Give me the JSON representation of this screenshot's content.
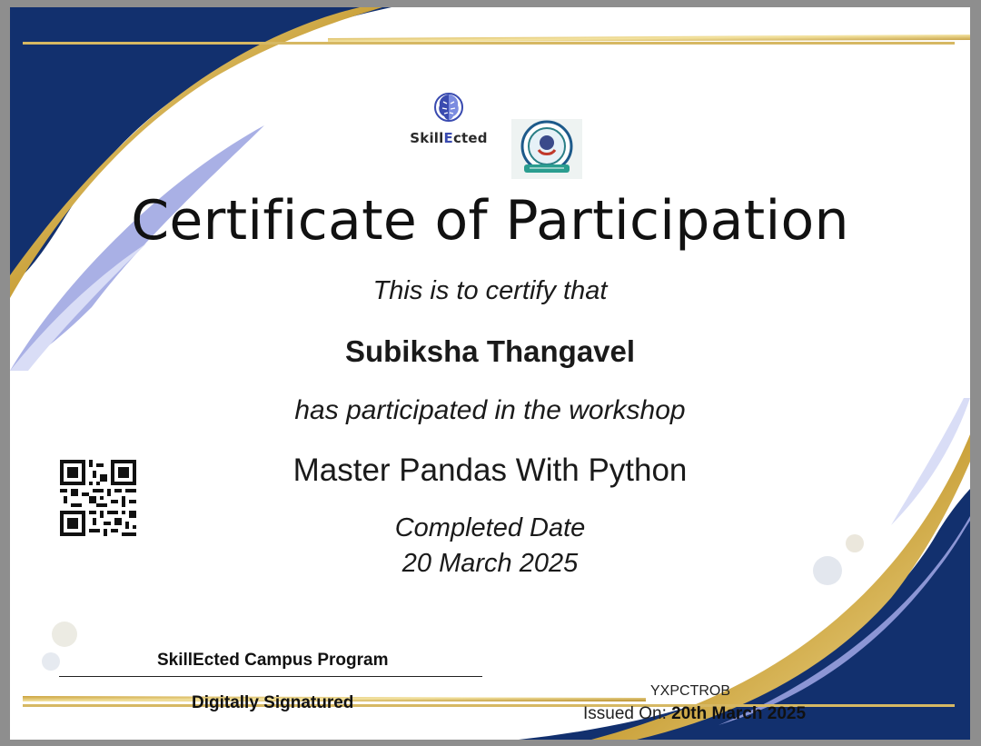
{
  "logo": {
    "brand_prefix": "Skill",
    "brand_highlight": "E",
    "brand_suffix": "cted"
  },
  "certificate": {
    "title": "Certificate of Participation",
    "certify_line": "This is to certify that",
    "recipient_name": "Subiksha Thangavel",
    "participation_line": "has participated in the workshop",
    "workshop_name": "Master Pandas With Python",
    "completed_label": "Completed Date",
    "completed_date": "20 March 2025"
  },
  "footer": {
    "program": "SkillEcted Campus Program",
    "signature_note": "Digitally Signatured",
    "certificate_id": "YXPCTROB",
    "issued_label": "Issued On: ",
    "issued_date": "20th March 2025"
  },
  "colors": {
    "navy": "#12306e",
    "gold": "#d9b64e",
    "lavender": "#9aa2e0",
    "text": "#111111"
  },
  "icons": [
    "brain-logo-icon",
    "college-seal-icon",
    "qr-code-icon"
  ]
}
